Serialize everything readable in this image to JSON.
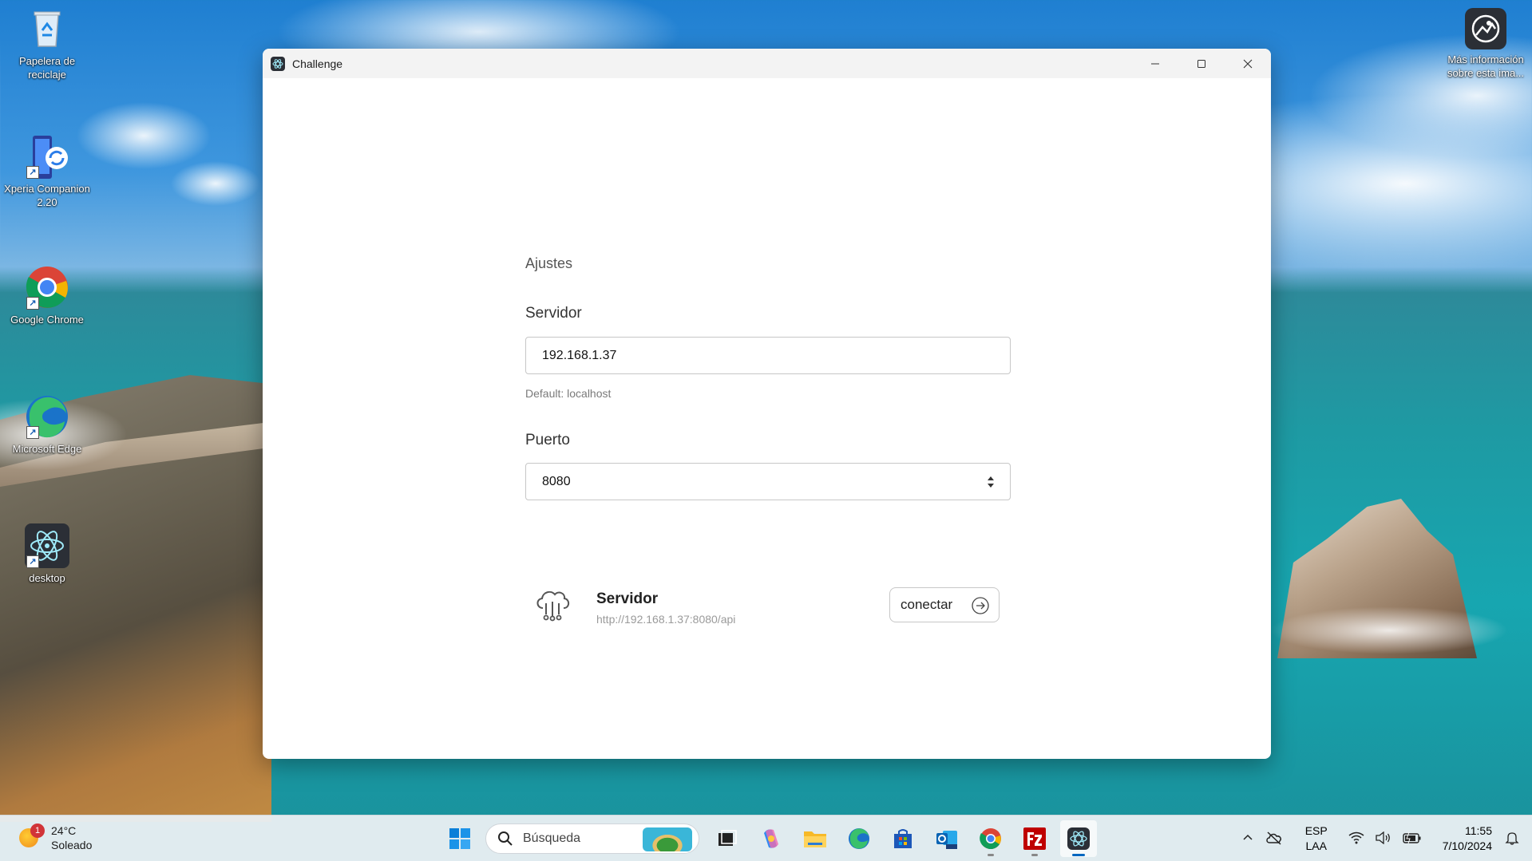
{
  "window": {
    "title": "Challenge",
    "controls": {
      "minimize": "minimize-icon",
      "maximize": "maximize-icon",
      "close": "close-icon"
    }
  },
  "settings": {
    "heading": "Ajustes",
    "server": {
      "label": "Servidor",
      "value": "192.168.1.37",
      "hint": "Default: localhost"
    },
    "port": {
      "label": "Puerto",
      "value": "8080"
    },
    "connection": {
      "icon": "cloud-network-icon",
      "title": "Servidor",
      "url": "http://192.168.1.37:8080/api",
      "button_label": "conectar",
      "button_icon": "arrow-right-circle-icon"
    }
  },
  "desktop": {
    "icons": [
      {
        "label": "Papelera de reciclaje",
        "icon": "recycle-bin-icon"
      },
      {
        "label": "Xperia Companion 2.20",
        "icon": "xperia-companion-icon"
      },
      {
        "label": "Google Chrome",
        "icon": "chrome-icon"
      },
      {
        "label": "Microsoft Edge",
        "icon": "edge-icon"
      },
      {
        "label": "desktop",
        "icon": "electron-icon"
      }
    ],
    "spotlight": {
      "label": "Más información sobre esta ima...",
      "icon": "spotlight-icon"
    }
  },
  "taskbar": {
    "weather": {
      "badge": "1",
      "temp": "24°C",
      "condition": "Soleado"
    },
    "search_placeholder": "Búsqueda",
    "apps": [
      "start-icon",
      "task-view-icon",
      "copilot-icon",
      "file-explorer-icon",
      "edge-icon",
      "store-icon",
      "outlook-icon",
      "chrome-icon",
      "filezilla-icon",
      "electron-app-icon"
    ],
    "tray": {
      "lang_top": "ESP",
      "lang_bottom": "LAA",
      "time": "11:55",
      "date": "7/10/2024"
    }
  }
}
